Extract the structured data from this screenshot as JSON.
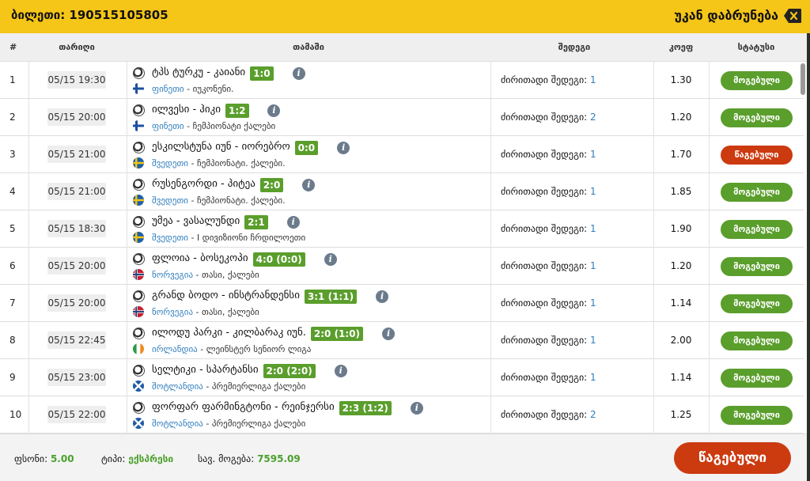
{
  "header": {
    "ticket": "ბილეთი: 190515105805",
    "back": "უკან დაბრუნება"
  },
  "columns": {
    "num": "#",
    "date": "თარიღი",
    "game": "თამაში",
    "result": "შედეგი",
    "odd": "კოეფ",
    "status": "სტატუსი"
  },
  "colors": {
    "win": "#5a9e2c",
    "lose": "#cc3a10",
    "accent": "#f5c518"
  },
  "rows": [
    {
      "num": "1",
      "date": "05/15 19:30",
      "match": "ტპს ტურკუ - კაიანი",
      "score": "1:0",
      "country": "ფინეთი",
      "league": " - იუკონენი.",
      "flag": "fi",
      "result_label": "ძირითადი შედეგი: ",
      "pick": "1",
      "odd": "1.30",
      "status": "მოგებული",
      "status_type": "win"
    },
    {
      "num": "2",
      "date": "05/15 20:00",
      "match": "ილვესი - ჰიკი",
      "score": "1:2",
      "country": "ფინეთი",
      "league": " - ჩემპიონატი ქალები",
      "flag": "fi",
      "result_label": "ძირითადი შედეგი: ",
      "pick": "2",
      "odd": "1.20",
      "status": "მოგებული",
      "status_type": "win"
    },
    {
      "num": "3",
      "date": "05/15 21:00",
      "match": "ესკილსტუნა იუნ - იორებრო",
      "score": "0:0",
      "country": "შვედეთი",
      "league": " - ჩემპიონატი. ქალები.",
      "flag": "se",
      "result_label": "ძირითადი შედეგი: ",
      "pick": "1",
      "odd": "1.70",
      "status": "წაგებული",
      "status_type": "lose"
    },
    {
      "num": "4",
      "date": "05/15 21:00",
      "match": "რუსენგორდი - პიტეა",
      "score": "2:0",
      "country": "შვედეთი",
      "league": " - ჩემპიონატი. ქალები.",
      "flag": "se",
      "result_label": "ძირითადი შედეგი: ",
      "pick": "1",
      "odd": "1.85",
      "status": "მოგებული",
      "status_type": "win"
    },
    {
      "num": "5",
      "date": "05/15 18:30",
      "match": "უმეა - ვასალუნდი",
      "score": "2:1",
      "country": "შვედეთი",
      "league": " - I დივიზიონი ჩრდილოეთი",
      "flag": "se",
      "result_label": "ძირითადი შედეგი: ",
      "pick": "1",
      "odd": "1.90",
      "status": "მოგებული",
      "status_type": "win"
    },
    {
      "num": "6",
      "date": "05/15 20:00",
      "match": "ფლოია - ბოსეკოპი",
      "score": "4:0 (0:0)",
      "country": "ნორვეგია",
      "league": " - თასი, ქალები",
      "flag": "no",
      "result_label": "ძირითადი შედეგი: ",
      "pick": "1",
      "odd": "1.20",
      "status": "მოგებული",
      "status_type": "win"
    },
    {
      "num": "7",
      "date": "05/15 20:00",
      "match": "გრანდ ბოდო - ინსტრანდენსი",
      "score": "3:1 (1:1)",
      "country": "ნორვეგია",
      "league": " - თასი, ქალები",
      "flag": "no",
      "result_label": "ძირითადი შედეგი: ",
      "pick": "1",
      "odd": "1.14",
      "status": "მოგებული",
      "status_type": "win"
    },
    {
      "num": "8",
      "date": "05/15 22:45",
      "match": "ილოდუ პარკი - კილბარაკ იუნ.",
      "score": "2:0 (1:0)",
      "country": "ირლანდია",
      "league": " - ლეინსტერ სენიორ ლიგა",
      "flag": "ie",
      "result_label": "ძირითადი შედეგი: ",
      "pick": "1",
      "odd": "2.00",
      "status": "მოგებული",
      "status_type": "win"
    },
    {
      "num": "9",
      "date": "05/15 23:00",
      "match": "სელტიკი - სპარტანსი",
      "score": "2:0 (2:0)",
      "country": "შოტლანდია",
      "league": " - პრემიერლიგა ქალები",
      "flag": "sc",
      "result_label": "ძირითადი შედეგი: ",
      "pick": "1",
      "odd": "1.14",
      "status": "მოგებული",
      "status_type": "win"
    },
    {
      "num": "10",
      "date": "05/15 22:00",
      "match": "ფორფარ ფარმინგტონი - რეინჯერსი",
      "score": "2:3 (1:2)",
      "country": "შოტლანდია",
      "league": " - პრემიერლიგა ქალები",
      "flag": "sc",
      "result_label": "ძირითადი შედეგი: ",
      "pick": "2",
      "odd": "1.25",
      "status": "მოგებული",
      "status_type": "win"
    }
  ],
  "footer": {
    "stake_label": "ფსონი: ",
    "stake": "5.00",
    "type_label": "ტიპი: ",
    "type": "ექსპრესი",
    "payout_label": "სავ. მოგება: ",
    "payout": "7595.09",
    "status": "წაგებული"
  }
}
